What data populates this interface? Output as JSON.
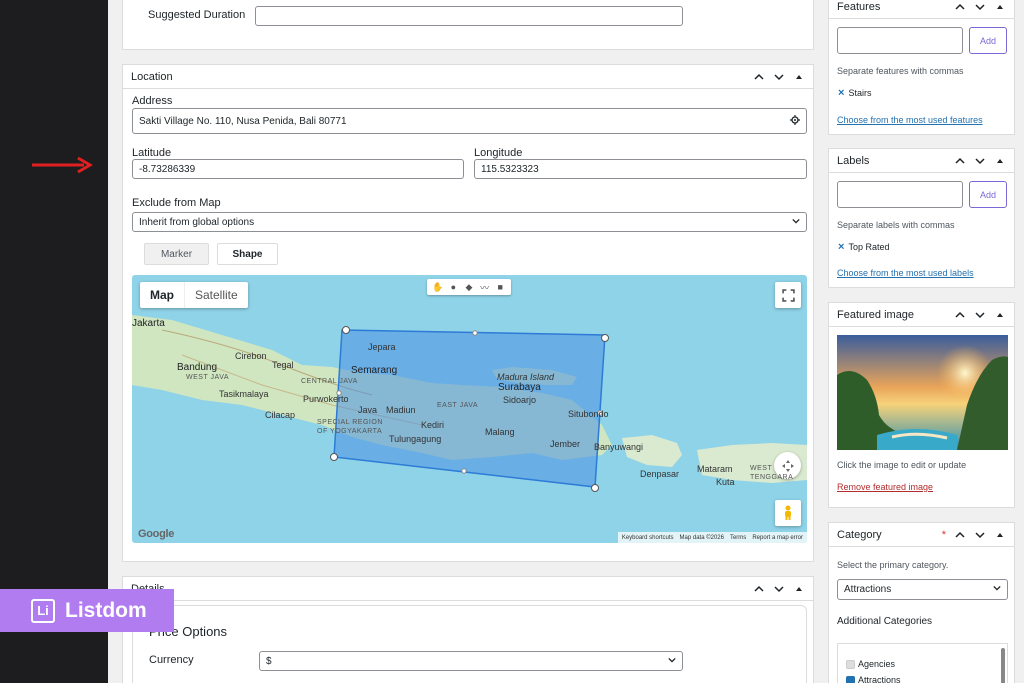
{
  "duration": {
    "label": "Suggested Duration",
    "value": ""
  },
  "location": {
    "title": "Location",
    "address_label": "Address",
    "address_value": "Sakti Village No. 110, Nusa Penida, Bali 80771",
    "lat_label": "Latitude",
    "lat_value": "-8.73286339",
    "lng_label": "Longitude",
    "lng_value": "115.5323323",
    "exclude_label": "Exclude from Map",
    "exclude_value": "Inherit from global options",
    "marker_label": "Marker",
    "shape_label": "Shape",
    "map": {
      "map_type": "Map",
      "satellite_type": "Satellite",
      "places": {
        "jakarta": "Jakarta",
        "cirebon": "Cirebon",
        "tegal": "Tegal",
        "bandung": "Bandung",
        "west_java": "WEST JAVA",
        "central_java": "CENTRAL JAVA",
        "tasikmalaya": "Tasikmalaya",
        "purwokerto": "Purwokerto",
        "cilacap": "Cilacap",
        "special_region": "SPECIAL REGION",
        "of_yogyakarta": "OF YOGYAKARTA",
        "jepara": "Jepara",
        "semarang": "Semarang",
        "madura": "Madura Island",
        "surabaya": "Surabaya",
        "sidoarjo": "Sidoarjo",
        "java": "Java",
        "madiun": "Madiun",
        "east_java": "EAST JAVA",
        "kediri": "Kediri",
        "situbondo": "Situbondo",
        "tulungagung": "Tulungagung",
        "malang": "Malang",
        "jember": "Jember",
        "banyuwangi": "Banyuwangi",
        "denpasar": "Denpasar",
        "mataram": "Mataram",
        "kuta": "Kuta",
        "west": "WEST",
        "tenggara": "TENGGARA"
      },
      "footer": {
        "shortcuts": "Keyboard shortcuts",
        "data": "Map data ©2026",
        "terms": "Terms",
        "report": "Report a map error"
      },
      "google": "Google"
    }
  },
  "details": {
    "title": "Details",
    "price_options": "Price Options",
    "currency_label": "Currency",
    "currency_value": "$"
  },
  "brand": {
    "logo_letter": "Li",
    "name": "Listdom"
  },
  "features": {
    "title": "Features",
    "add_label": "Add",
    "help": "Separate features with commas",
    "tag": "Stairs",
    "choose": "Choose from the most used features"
  },
  "labels": {
    "title": "Labels",
    "add_label": "Add",
    "help": "Separate labels with commas",
    "tag": "Top Rated",
    "choose": "Choose from the most used labels"
  },
  "featured_image": {
    "title": "Featured image",
    "help": "Click the image to edit or update",
    "remove": "Remove featured image"
  },
  "category": {
    "title": "Category",
    "required": "*",
    "help": "Select the primary category.",
    "selected": "Attractions",
    "additional": "Additional Categories",
    "items": [
      "Agencies",
      "Attractions"
    ]
  },
  "colors": {
    "accent": "#7b68d6",
    "link": "#2271b1",
    "brand": "#b07cf0",
    "shape_fill": "#4a90e2"
  }
}
